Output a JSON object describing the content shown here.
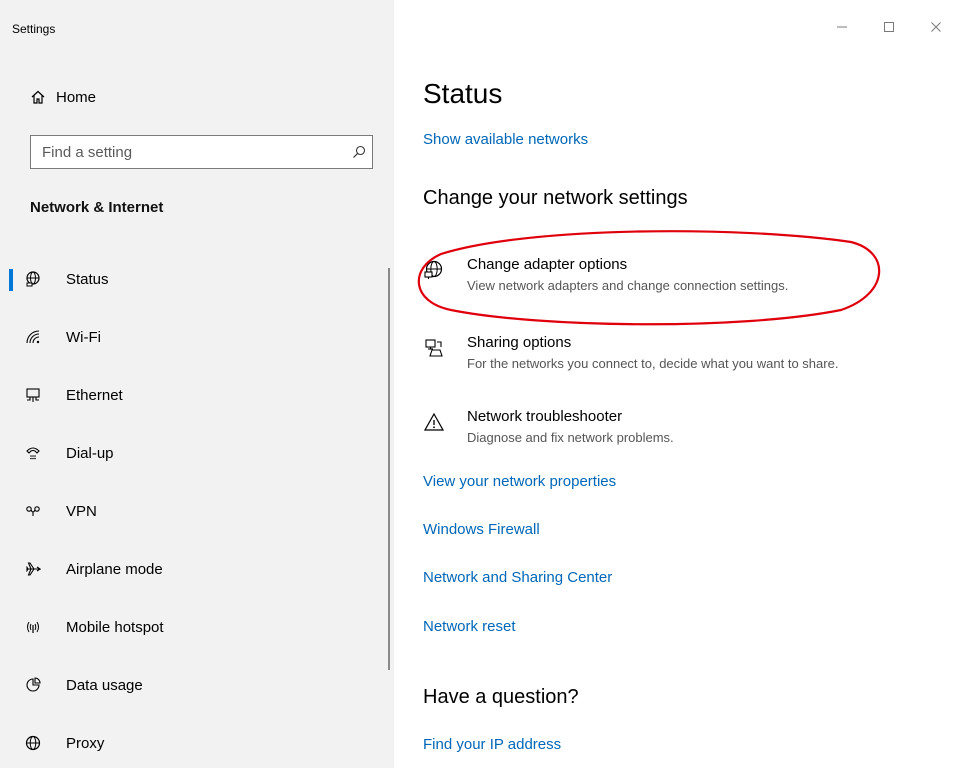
{
  "window": {
    "title": "Settings",
    "controls": [
      "—",
      "☐",
      "✕"
    ]
  },
  "sidebar": {
    "home_label": "Home",
    "search": {
      "placeholder": "Find a setting"
    },
    "section_title": "Network & Internet",
    "items": [
      {
        "label": "Status",
        "icon": "status-globe-icon",
        "active": true
      },
      {
        "label": "Wi-Fi",
        "icon": "wifi-icon"
      },
      {
        "label": "Ethernet",
        "icon": "ethernet-icon"
      },
      {
        "label": "Dial-up",
        "icon": "dialup-icon"
      },
      {
        "label": "VPN",
        "icon": "vpn-icon"
      },
      {
        "label": "Airplane mode",
        "icon": "airplane-icon"
      },
      {
        "label": "Mobile hotspot",
        "icon": "hotspot-icon"
      },
      {
        "label": "Data usage",
        "icon": "data-usage-icon"
      },
      {
        "label": "Proxy",
        "icon": "proxy-globe-icon"
      }
    ]
  },
  "main": {
    "title": "Status",
    "show_networks_link": "Show available networks",
    "change_heading": "Change your network settings",
    "options": [
      {
        "title": "Change adapter options",
        "desc": "View network adapters and change connection settings.",
        "icon": "adapter-icon"
      },
      {
        "title": "Sharing options",
        "desc": "For the networks you connect to, decide what you want to share.",
        "icon": "sharing-icon"
      },
      {
        "title": "Network troubleshooter",
        "desc": "Diagnose and fix network problems.",
        "icon": "warning-icon"
      }
    ],
    "links": [
      "View your network properties",
      "Windows Firewall",
      "Network and Sharing Center",
      "Network reset"
    ],
    "question_heading": "Have a question?",
    "find_ip_link": "Find your IP address"
  },
  "colors": {
    "accent": "#0078d7",
    "link": "#0067b8",
    "sidebar_bg": "#f2f2f2",
    "highlight_ellipse": "#e0000b"
  }
}
